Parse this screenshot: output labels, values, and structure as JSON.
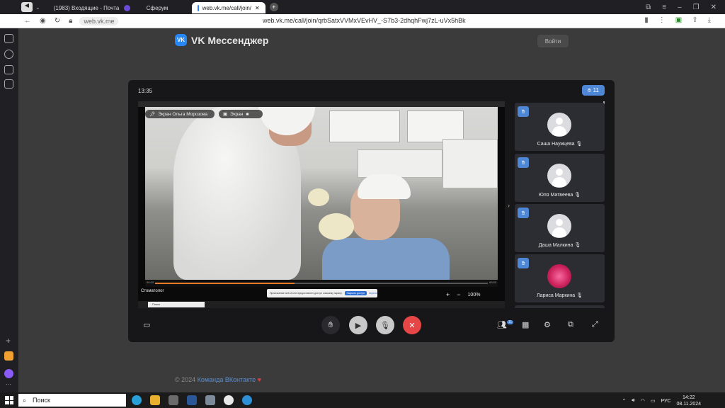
{
  "browser": {
    "tabs": [
      {
        "label": "(1983) Входящие - Почта",
        "color": "#2787f5"
      },
      {
        "label": "Сферум",
        "color": "#6b4bd8"
      },
      {
        "label": "web.vk.me/call/join/",
        "color": "#2787f5",
        "active": true
      }
    ],
    "domain": "web.vk.me",
    "url": "web.vk.me/call/join/qrbSatxVVMxVEvHV_-S7b3-2dhqhFwj7zL-uVx5hBk"
  },
  "page": {
    "logo_text": "VK Мессенджер",
    "login_button": "Войти",
    "footer": {
      "copyright": "© 2024",
      "link": "Команда ВКонтакте"
    }
  },
  "call": {
    "time": "13:35",
    "raised_hands": "11",
    "screen_owner_chip": "Экран Ольга Морозова",
    "screen_chip": "Экран",
    "video_caption": "Стоматолог",
    "progress_fraction": 0.42,
    "player_time_left": "00:24",
    "player_time_right": "00:53",
    "zoom_plus": "+",
    "zoom_minus": "−",
    "zoom_percent": "100%",
    "share_banner": {
      "text": "Приложение web.vk.me предоставлен доступ к вашему экрану.",
      "button": "Закрыть доступ",
      "link": "Скрыть"
    },
    "inner_search": "Поиск",
    "participants": [
      {
        "name": "Саша Наумцева",
        "avatar": "default"
      },
      {
        "name": "Юля Матвеева",
        "avatar": "default"
      },
      {
        "name": "Даша Малкина",
        "avatar": "default"
      },
      {
        "name": "Лариса Маркина",
        "avatar": "flower"
      }
    ],
    "participants_badge": "11"
  },
  "taskbar": {
    "search": "Поиск",
    "lang": "РУС",
    "time": "14:22",
    "date": "08.11.2024"
  },
  "colors": {
    "accent": "#4d87d6",
    "end_call": "#e64646",
    "vk_blue": "#2787f5"
  }
}
